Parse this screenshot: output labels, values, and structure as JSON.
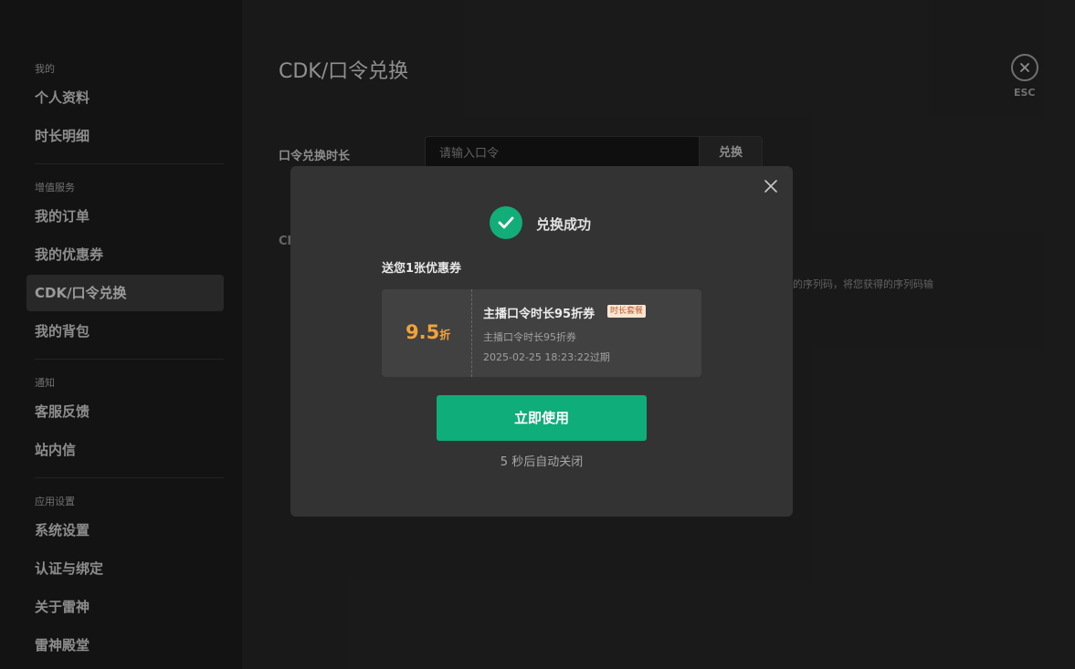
{
  "sidebar": {
    "sections": [
      {
        "label": "我的",
        "items": [
          "个人资料",
          "时长明细"
        ]
      },
      {
        "label": "增值服务",
        "items": [
          "我的订单",
          "我的优惠券",
          "CDK/口令兑换",
          "我的背包"
        ]
      },
      {
        "label": "通知",
        "items": [
          "客服反馈",
          "站内信"
        ]
      },
      {
        "label": "应用设置",
        "items": [
          "系统设置",
          "认证与绑定",
          "关于雷神",
          "雷神殿堂"
        ]
      }
    ]
  },
  "main": {
    "title": "CDK/口令兑换",
    "esc_label": "ESC",
    "command_label": "口令兑换时长",
    "command_placeholder": "请输入口令",
    "command_button": "兑换",
    "cdk_label": "Cl",
    "cdk_desc_fragment": "组成的序列码，将您获得的序列码输"
  },
  "modal": {
    "success_text": "兑换成功",
    "gift_text": "送您1张优惠券",
    "coupon": {
      "discount_value": "9.5",
      "discount_unit": "折",
      "title": "主播口令时长95折券",
      "tag": "时长套餐",
      "subtitle": "主播口令时长95折券",
      "expiry": "2025-02-25 18:23:22过期"
    },
    "use_button": "立即使用",
    "auto_close": "5 秒后自动关闭"
  },
  "colors": {
    "accent_green": "#0fad7a",
    "discount_orange": "#f2a338",
    "tag_bg": "#fbe6d1",
    "tag_text": "#c4582a"
  }
}
